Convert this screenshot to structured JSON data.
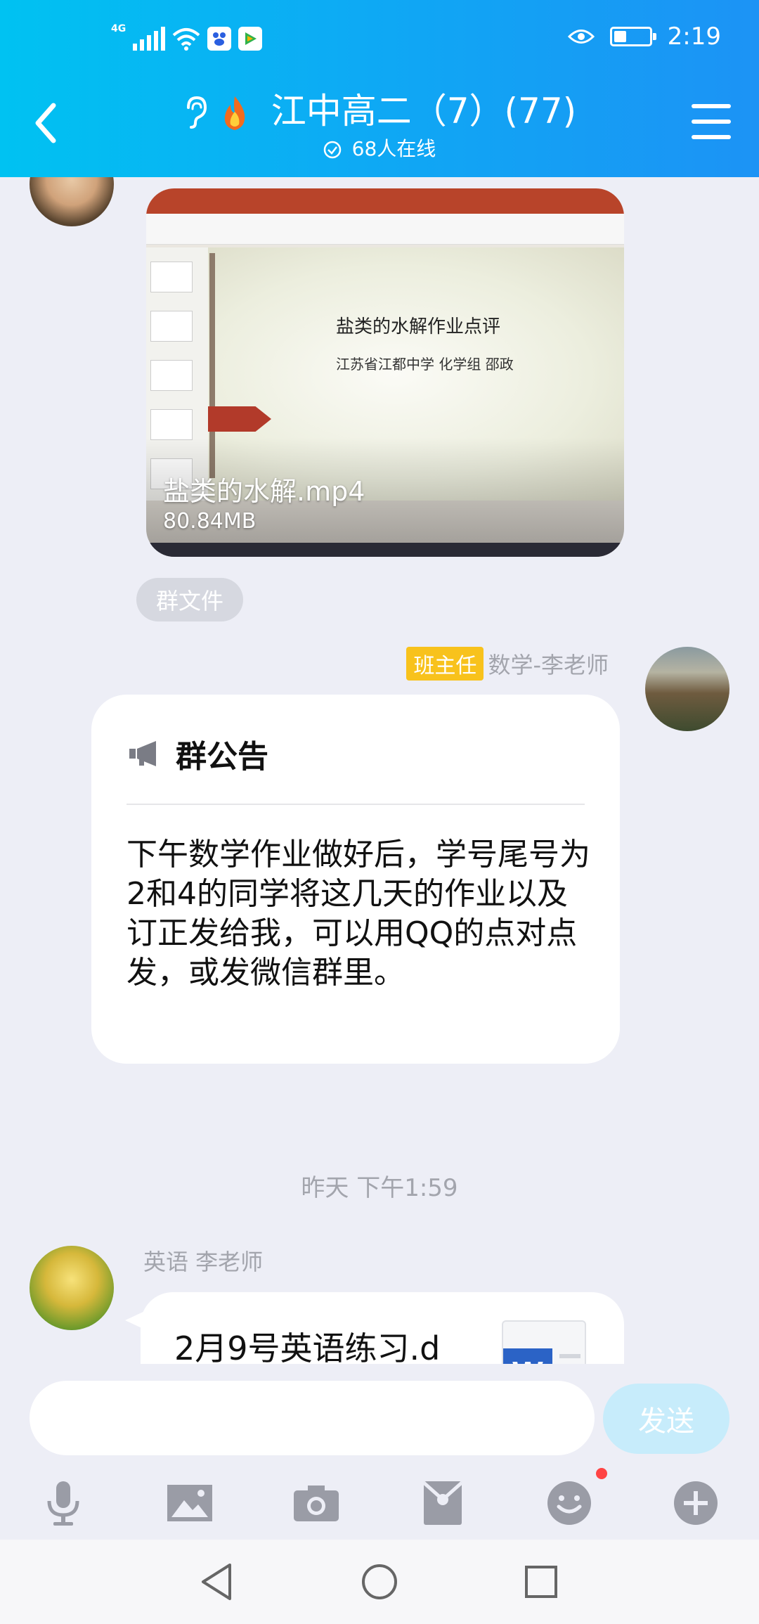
{
  "status_bar": {
    "network": "4G",
    "time": "2:19",
    "battery_level": 0.35
  },
  "header": {
    "title": "江中高二（7）(77)",
    "online_text": "68人在线"
  },
  "video_message": {
    "file_name": "盐类的水解.mp4",
    "file_size": "80.84MB",
    "slide_title": "盐类的水解作业点评",
    "slide_subtitle": "江苏省江都中学 化学组 邵政"
  },
  "group_file_tag": "群文件",
  "notice_message": {
    "role_badge": "班主任",
    "sender": "数学-李老师",
    "heading": "群公告",
    "body": "下午数学作业做好后，学号尾号为2和4的同学将这几天的作业以及订正发给我，可以用QQ的点对点发，或发微信群里。"
  },
  "timestamp": "昨天 下午1:59",
  "file_message": {
    "sender": "英语 李老师",
    "file_name": "2月9号英语练习.d"
  },
  "input": {
    "placeholder": "",
    "send_label": "发送"
  },
  "toolbar": {
    "icons": [
      "microphone-icon",
      "image-icon",
      "camera-icon",
      "red-packet-icon",
      "emoji-icon",
      "plus-icon"
    ]
  },
  "colors": {
    "header_gradient_start": "#00c2f2",
    "header_gradient_end": "#1c93f5",
    "badge": "#f8c21c",
    "send_button": "#c7ecfb"
  }
}
